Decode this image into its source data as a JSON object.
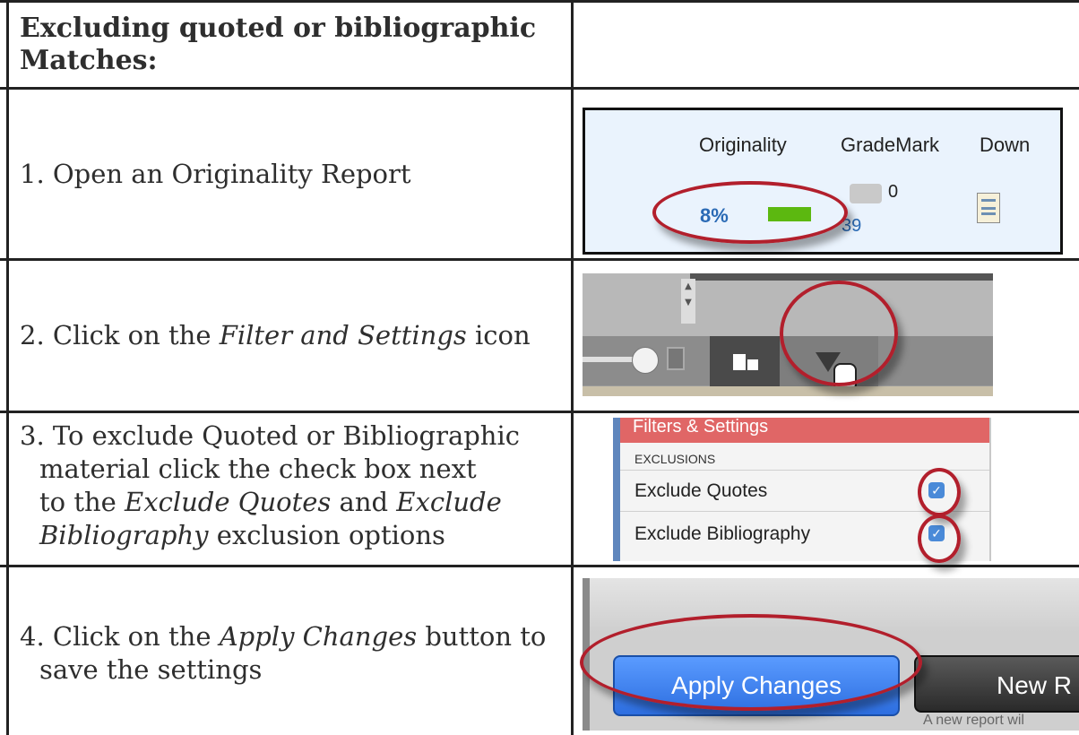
{
  "header": {
    "title": "Excluding quoted or bibliographic Matches:"
  },
  "steps": [
    {
      "pre": "1. Open an Originality Report",
      "em": "",
      "post": "",
      "em2": "",
      "post2": ""
    },
    {
      "pre": "2. Click on the ",
      "em": "Filter and Settings",
      "post": " icon"
    },
    {
      "line1": "3. To exclude Quoted or Bibliographic",
      "line2": "material click the check box next",
      "line3_pre": "to the ",
      "line3_em": "Exclude Quotes",
      "line3_mid": " and ",
      "line3_em2": "Exclude",
      "line4_em": "Bibliography",
      "line4_post": " exclusion options"
    },
    {
      "pre": "4. Click on the ",
      "em": "Apply Changes",
      "post": " button to",
      "line2": "save the settings"
    }
  ],
  "shot1": {
    "col_originality": "Originality",
    "col_grademark": "GradeMark",
    "col_download": "Down",
    "percent": "8%",
    "comment_count": "0",
    "mark_count": "39",
    "bar_color": "#5cb810"
  },
  "shot2": {
    "up": "▲",
    "down": "▼"
  },
  "shot3": {
    "panel_title": "Filters & Settings",
    "section": "EXCLUSIONS",
    "opt1": "Exclude Quotes",
    "opt2": "Exclude Bibliography",
    "check": "✓"
  },
  "shot4": {
    "apply_label": "Apply Changes",
    "new_label": "New R",
    "note": "A new report wil"
  },
  "colors": {
    "ring": "#b21f2c",
    "apply_blue": "#3478f0",
    "panel_red": "#e06666"
  }
}
